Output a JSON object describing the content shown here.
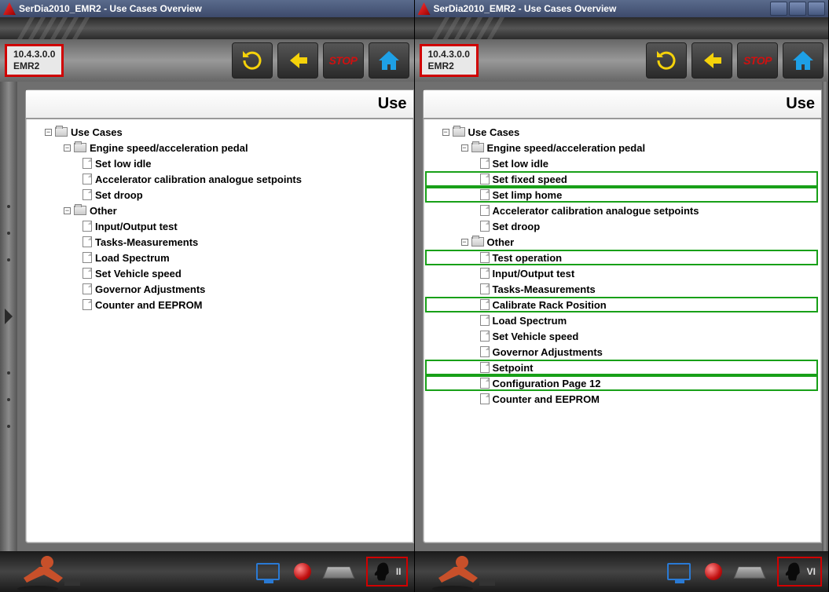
{
  "title": "SerDia2010_EMR2 - Use Cases Overview",
  "version_line1": "10.4.3.0.0",
  "version_line2": "EMR2",
  "panel_head": "Use",
  "stop_label": "STOP",
  "left": {
    "root": "Use Cases",
    "g1": "Engine speed/acceleration pedal",
    "g1_items": [
      "Set low idle",
      "Accelerator calibration analogue setpoints",
      "Set droop"
    ],
    "g2": "Other",
    "g2_items": [
      "Input/Output test",
      "Tasks-Measurements",
      "Load Spectrum",
      "Set Vehicle speed",
      "Governor Adjustments",
      "Counter and EEPROM"
    ],
    "head_suffix": "II"
  },
  "right": {
    "root": "Use Cases",
    "g1": "Engine speed/acceleration pedal",
    "g1_items": [
      {
        "t": "Set low idle",
        "hl": false
      },
      {
        "t": "Set fixed speed",
        "hl": true
      },
      {
        "t": "Set limp home",
        "hl": true
      },
      {
        "t": "Accelerator calibration analogue setpoints",
        "hl": false
      },
      {
        "t": "Set droop",
        "hl": false
      }
    ],
    "g2": "Other",
    "g2_items": [
      {
        "t": "Test operation",
        "hl": true
      },
      {
        "t": "Input/Output test",
        "hl": false
      },
      {
        "t": "Tasks-Measurements",
        "hl": false
      },
      {
        "t": "Calibrate Rack Position",
        "hl": true
      },
      {
        "t": "Load Spectrum",
        "hl": false
      },
      {
        "t": "Set Vehicle speed",
        "hl": false
      },
      {
        "t": "Governor Adjustments",
        "hl": false
      },
      {
        "t": "Setpoint",
        "hl": true
      },
      {
        "t": "Configuration Page 12",
        "hl": true
      },
      {
        "t": "Counter and EEPROM",
        "hl": false
      }
    ],
    "head_suffix": "VI"
  }
}
